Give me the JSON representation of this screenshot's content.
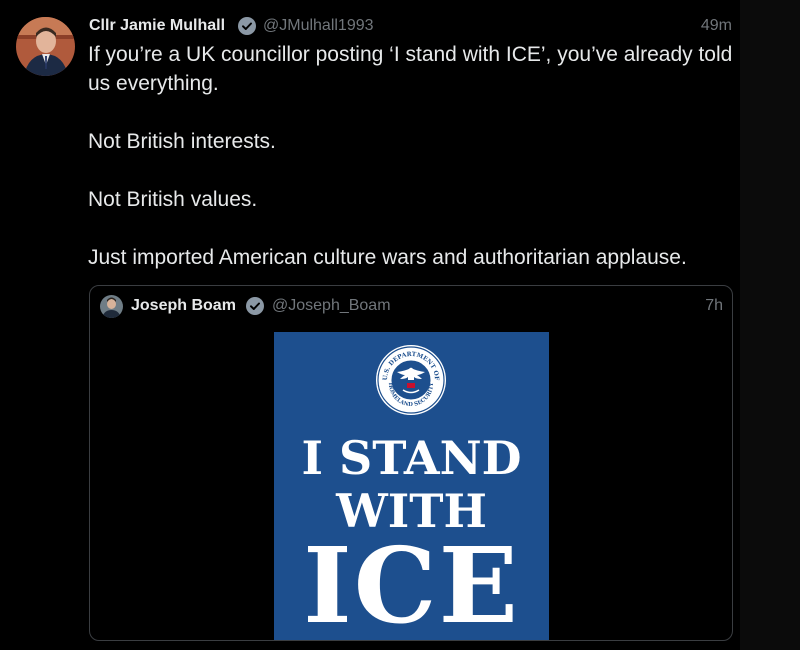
{
  "tweet": {
    "author": {
      "display_name": "Cllr Jamie Mulhall",
      "handle": "@JMulhall1993",
      "verified": true,
      "avatar_icon": "profile-photo"
    },
    "time": "49m",
    "paragraphs": [
      "If you’re a UK councillor posting ‘I stand with ICE’, you’ve already told us everything.",
      "Not British interests.",
      "Not British values.",
      "Just imported American culture wars and authoritarian applause."
    ]
  },
  "quoted_tweet": {
    "author": {
      "display_name": "Joseph Boam",
      "handle": "@Joseph_Boam",
      "verified": true,
      "avatar_icon": "profile-photo"
    },
    "time": "7h",
    "image": {
      "lines": [
        "I STAND",
        "WITH",
        "ICE"
      ],
      "seal_text": "U.S. DEPARTMENT OF HOMELAND SECURITY",
      "background_color": "#1d4f8e"
    }
  },
  "colors": {
    "background": "#000000",
    "text": "#e7e9ea",
    "muted": "#71767b",
    "verified": "#8b98a5",
    "border": "#3a3d41"
  }
}
